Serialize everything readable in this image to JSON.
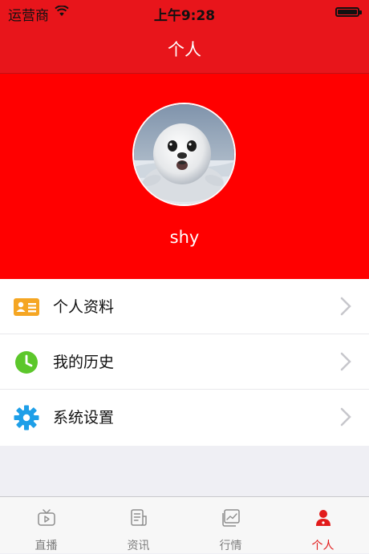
{
  "status_bar": {
    "carrier": "运营商",
    "time": "上午9:28",
    "wifi_icon": "wifi-icon",
    "battery_icon": "battery-icon"
  },
  "nav": {
    "title": "个人"
  },
  "profile": {
    "username": "shy",
    "avatar": "seal-avatar"
  },
  "menu": [
    {
      "label": "个人资料",
      "icon": "id-card-icon",
      "color": "#f5a623"
    },
    {
      "label": "我的历史",
      "icon": "clock-icon",
      "color": "#5cc72b"
    },
    {
      "label": "系统设置",
      "icon": "gear-icon",
      "color": "#1e9fe8"
    }
  ],
  "tabs": [
    {
      "label": "直播",
      "icon": "tv-icon",
      "active": false
    },
    {
      "label": "资讯",
      "icon": "news-icon",
      "active": false
    },
    {
      "label": "行情",
      "icon": "chart-icon",
      "active": false
    },
    {
      "label": "个人",
      "icon": "person-icon",
      "active": true
    }
  ],
  "colors": {
    "nav_red": "#e8151b",
    "hero_red": "#ff0000",
    "active_tab": "#e21b1b"
  }
}
